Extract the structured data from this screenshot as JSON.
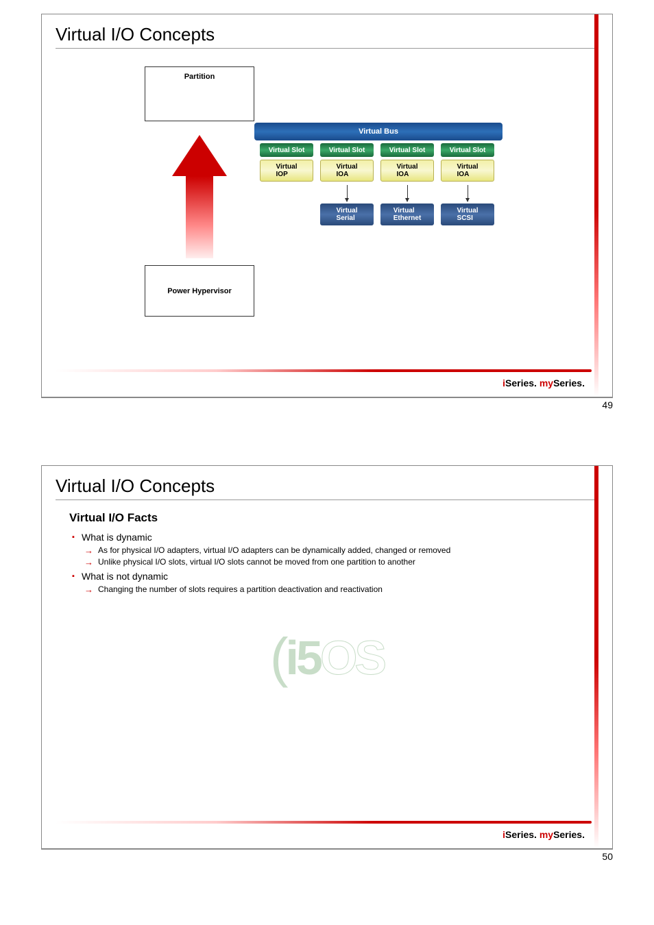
{
  "slide1": {
    "title": "Virtual I/O Concepts",
    "partition": "Partition",
    "hypervisor": "Power Hypervisor",
    "vbus": "Virtual Bus",
    "slot": "Virtual Slot",
    "iop": "Virtual\nIOP",
    "ioa": "Virtual\nIOA",
    "dev_serial": "Virtual\nSerial",
    "dev_eth": "Virtual\nEthernet",
    "dev_scsi": "Virtual\nSCSI",
    "page": "49"
  },
  "slide2": {
    "title": "Virtual I/O Concepts",
    "heading": "Virtual I/O Facts",
    "bullet1": "What is dynamic",
    "sub1a": "As for physical I/O adapters, virtual I/O adapters can be dynamically added, changed or removed",
    "sub1b": "Unlike physical I/O slots, virtual I/O slots cannot be moved from one partition to another",
    "bullet2": "What is not dynamic",
    "sub2a": "Changing the number of slots requires a partition deactivation and reactivation",
    "logo": "i5OS",
    "page": "50"
  },
  "brand": {
    "i": "i",
    "series1": "Series. ",
    "my": "my",
    "series2": "Series."
  }
}
